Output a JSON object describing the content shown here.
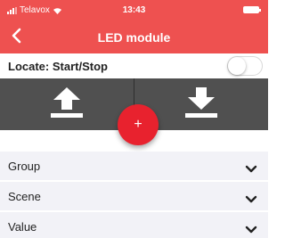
{
  "status": {
    "carrier": "Telavox",
    "time": "13:43"
  },
  "nav": {
    "title": "LED module"
  },
  "locate": {
    "label": "Locate: Start/Stop",
    "enabled": false
  },
  "fab": {
    "label": "+"
  },
  "list": {
    "items": [
      {
        "label": "Group"
      },
      {
        "label": "Scene"
      },
      {
        "label": "Value"
      }
    ]
  },
  "colors": {
    "header": "#ee5150",
    "controls": "#505050",
    "fab": "#e8222e",
    "list_bg": "#f2f2f7"
  }
}
